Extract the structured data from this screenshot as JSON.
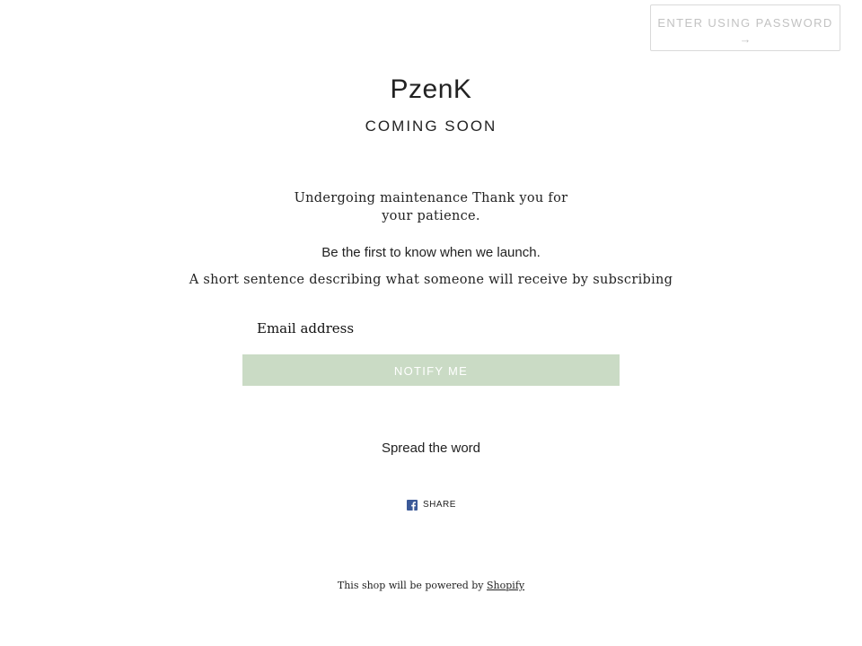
{
  "header": {
    "password_button_label": "ENTER USING PASSWORD",
    "password_button_arrow": "→"
  },
  "hero": {
    "shop_name": "PzenK",
    "status": "COMING SOON"
  },
  "content": {
    "message": "Undergoing maintenance Thank you for your patience.",
    "newsletter_heading": "Be the first to know when we launch.",
    "newsletter_description": "A short sentence describing what someone will receive by subscribing"
  },
  "form": {
    "email_placeholder": "Email address",
    "email_value": "",
    "submit_label": "NOTIFY ME",
    "submit_color": "#cadbc5"
  },
  "social": {
    "heading": "Spread the word",
    "share_icon": "facebook-icon",
    "share_label": "SHARE",
    "facebook_color": "#3b5998"
  },
  "footer": {
    "prefix": "This shop will be powered by",
    "link_label": "Shopify"
  }
}
